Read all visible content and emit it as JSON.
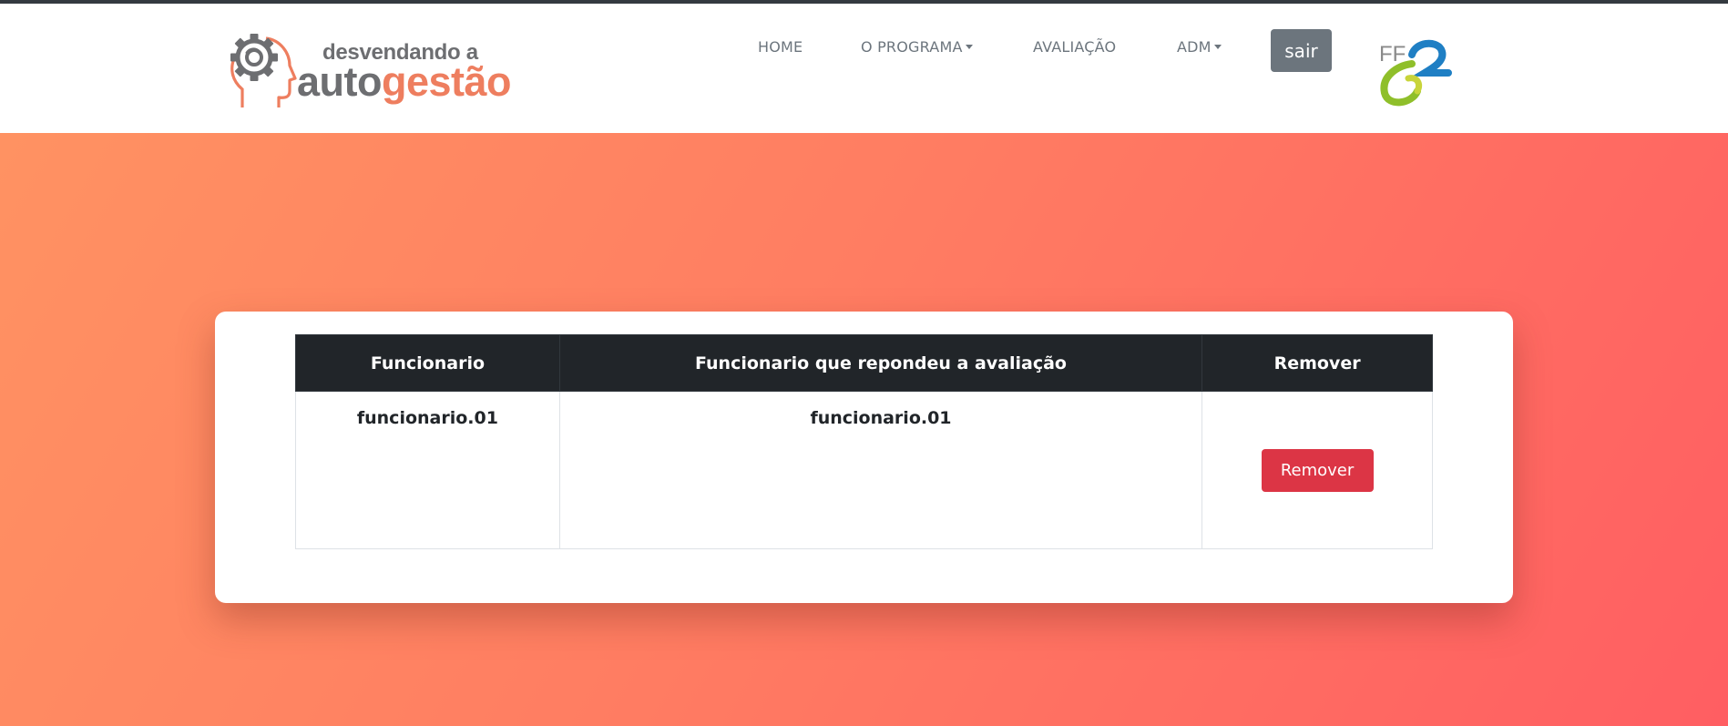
{
  "brand": {
    "line1": "desvendando a",
    "line2_part1": "auto",
    "line2_part2": "gestão"
  },
  "nav": {
    "home": "HOME",
    "programa": "O PROGRAMA",
    "avaliacao": "AVALIAÇÃO",
    "adm": "ADM",
    "sair": "sair"
  },
  "partner_logo": {
    "text": "FF"
  },
  "table": {
    "headers": [
      "Funcionario",
      "Funcionario que repondeu a avaliação",
      "Remover"
    ],
    "rows": [
      {
        "funcionario": "funcionario.01",
        "respondente": "funcionario.01",
        "action_label": "Remover"
      }
    ]
  },
  "colors": {
    "brand_orange": "#ee7e5f",
    "brand_gray": "#6d6e71",
    "danger": "#dc3545",
    "secondary": "#6c757d",
    "table_header": "#212529"
  }
}
